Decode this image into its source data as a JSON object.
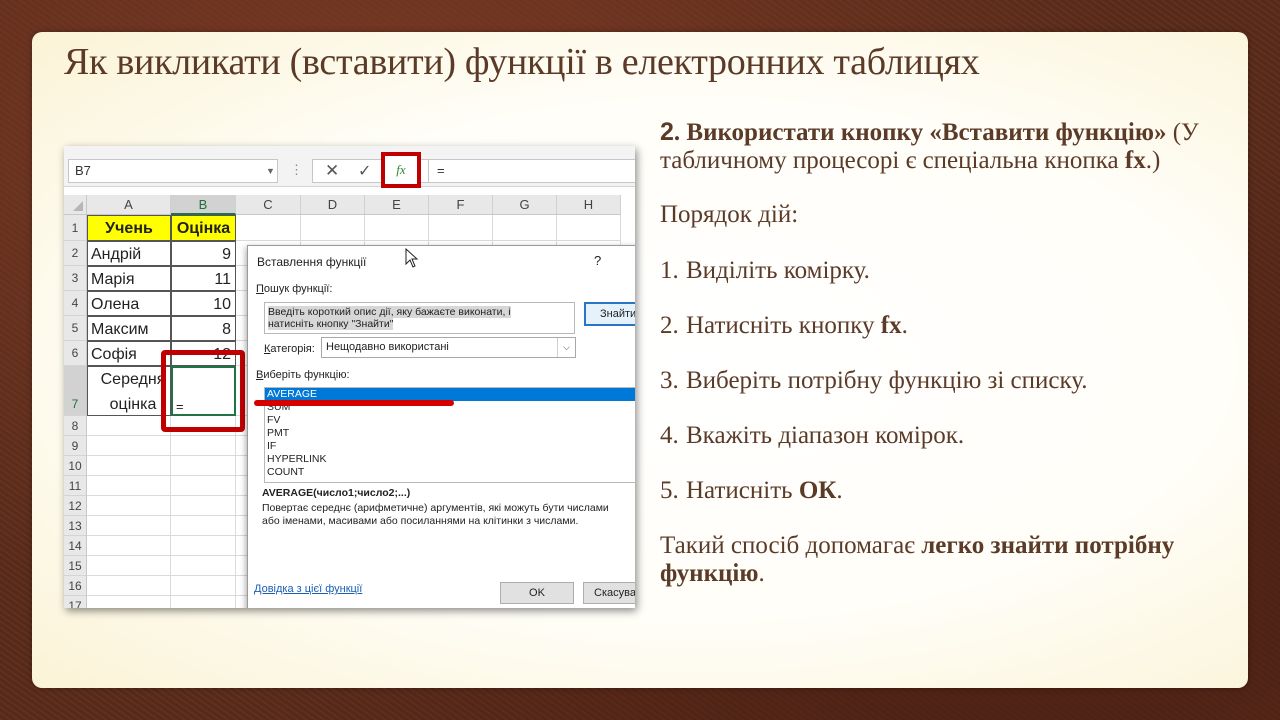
{
  "slide": {
    "title": "Як викликати (вставити) функції в електронних таблицях",
    "intro": {
      "num": "2",
      "bold": ". Використати кнопку «Вставити функцію»",
      "rest_a": " (У табличному процесорі є спеціальна кнопка ",
      "fx": "fx",
      "rest_b": ".)"
    },
    "order_label": "Порядок дій:",
    "steps": [
      {
        "num": "1.",
        "pre": " Виділіть комірку.",
        "bold": "",
        "post": ""
      },
      {
        "num": "2.",
        "pre": "Натисніть кнопку ",
        "bold": "fx",
        "post": "."
      },
      {
        "num": "3.",
        "pre": "Виберіть потрібну функцію зі списку.",
        "bold": "",
        "post": ""
      },
      {
        "num": "4.",
        "pre": "Вкажіть діапазон комірок.",
        "bold": "",
        "post": ""
      },
      {
        "num": "5.",
        "pre": "Натисніть ",
        "bold": "ОК",
        "post": "."
      }
    ],
    "outro": {
      "pre": "Такий спосіб допомагає ",
      "bold": "легко знайти потрібну функцію",
      "post": "."
    }
  },
  "excel": {
    "name_box": "B7",
    "formula": "=",
    "fx_label": "fx",
    "columns": [
      "A",
      "B",
      "C",
      "D",
      "E",
      "F",
      "G",
      "H"
    ],
    "rows": [
      "1",
      "2",
      "3",
      "4",
      "5",
      "6",
      "7",
      "8",
      "9",
      "10",
      "11",
      "12",
      "13",
      "14",
      "15",
      "16",
      "17"
    ],
    "headers": {
      "student": "Учень",
      "grade": "Оцінка"
    },
    "students": [
      {
        "name": "Андрій",
        "grade": "9"
      },
      {
        "name": "Марія",
        "grade": "11"
      },
      {
        "name": "Олена",
        "grade": "10"
      },
      {
        "name": "Максим",
        "grade": "8"
      },
      {
        "name": "Софія",
        "grade": "12"
      }
    ],
    "avg_label_1": "Середня",
    "avg_label_2": "оцінка",
    "active_cell_value": "=",
    "accent_color": "#c00000"
  },
  "dialog": {
    "title": "Вставлення функції",
    "help": "?",
    "search_label_u": "П",
    "search_label": "ошук функції:",
    "search_text_1": "Введіть короткий опис дії, яку бажаєте виконати, і",
    "search_text_2": "натисніть кнопку \"Знайти\"",
    "find_button": "Знайти",
    "category_label_u": "К",
    "category_label": "атегорія:",
    "category_value": "Нещодавно використані",
    "function_label_u": "В",
    "function_label": "иберіть функцію:",
    "functions": [
      "AVERAGE",
      "SUM",
      "FV",
      "PMT",
      "IF",
      "HYPERLINK",
      "COUNT"
    ],
    "signature": "AVERAGE(число1;число2;...)",
    "description_1": "Повертає середнє (арифметичне) аргументів, які можуть бути числами",
    "description_2": "або іменами, масивами або посиланнями на клітинки з числами.",
    "help_link": "Довідка з цієї функції",
    "ok": "OK",
    "cancel": "Скасувати"
  }
}
